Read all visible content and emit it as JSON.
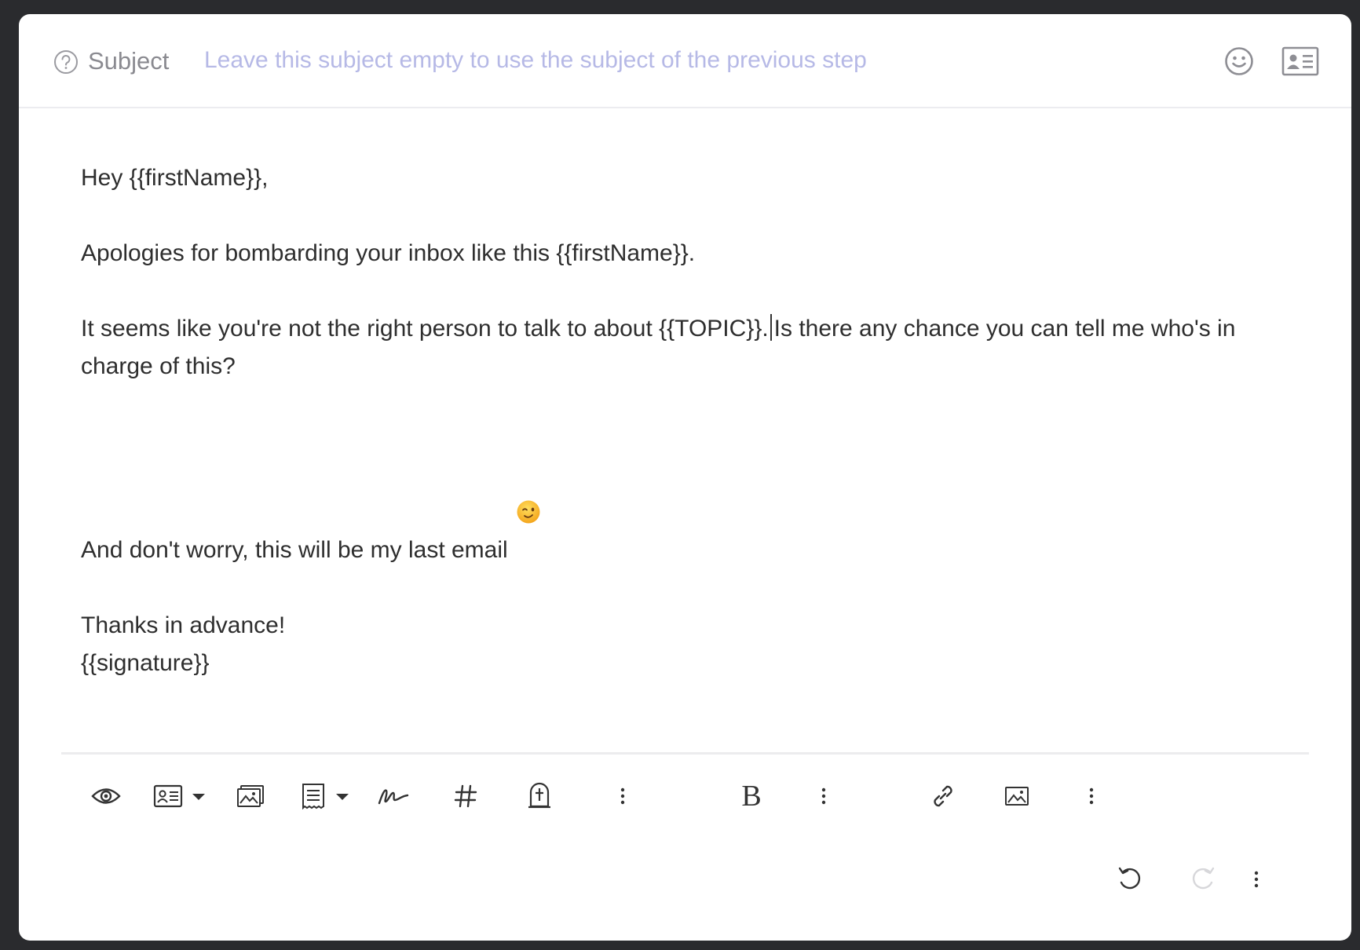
{
  "subject": {
    "label": "Subject",
    "placeholder": "Leave this subject empty to use the subject of the previous step",
    "value": ""
  },
  "body": {
    "greeting": "Hey {{firstName}},",
    "line_apology": "Apologies for bombarding your inbox like this {{firstName}}.",
    "line_topic_before_caret": "It seems like you're not the right person to talk to about {{TOPIC}}.",
    "line_topic_after_caret": "Is there any chance you can tell me who's in charge of this?",
    "line_last_email": "And don't worry, this will be my last email",
    "line_thanks": "Thanks in advance!",
    "signature": "{{signature}}"
  },
  "toolbar": {
    "bold_label": "B"
  },
  "icons": {
    "header": [
      "help-icon",
      "emoji-icon",
      "contact-card-icon"
    ],
    "toolbar": [
      "eye-icon",
      "contact-card-icon",
      "images-icon",
      "template-icon",
      "signature-icon",
      "hash-icon",
      "unsubscribe-icon",
      "more-icon",
      "bold-icon",
      "more-icon",
      "link-icon",
      "image-icon",
      "more-icon"
    ],
    "footer": [
      "undo-icon",
      "redo-icon",
      "more-icon"
    ]
  },
  "colors": {
    "placeholder": "#b6b9e6",
    "text": "#2e2e2e",
    "icon": "#333333",
    "disabled_icon": "#d7d7da",
    "backdrop": "#2a2b2e"
  }
}
